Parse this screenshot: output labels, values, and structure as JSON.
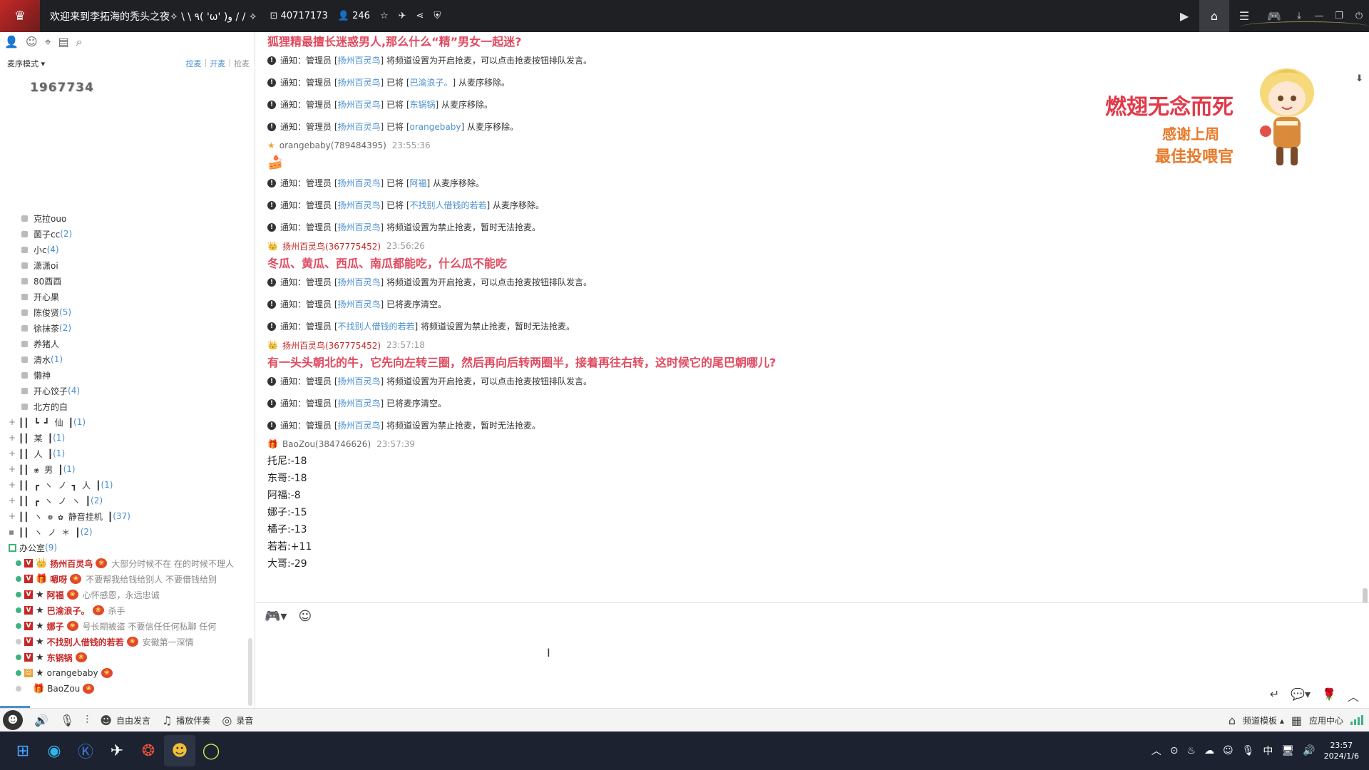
{
  "window": {
    "title": "欢迎来到李拓海的秃头之夜✧ \\ \\ ٩( 'ω' )و / / ✧",
    "channel_id": "40717173",
    "user_count": "246"
  },
  "left": {
    "mode_label": "麦序模式",
    "links": [
      "控麦",
      "开麦",
      "抢麦"
    ],
    "room_id": "1967734",
    "channels": [
      {
        "name": "克拉ouo",
        "count": ""
      },
      {
        "name": "菌子cc",
        "count": "(2)"
      },
      {
        "name": "小c",
        "count": "(4)"
      },
      {
        "name": "潇潇oi",
        "count": ""
      },
      {
        "name": "80酉酉",
        "count": ""
      },
      {
        "name": "开心果",
        "count": ""
      },
      {
        "name": "陈俊贤",
        "count": "(5)"
      },
      {
        "name": "徐抹茶",
        "count": "(2)"
      },
      {
        "name": "养猪人",
        "count": ""
      },
      {
        "name": "清水",
        "count": "(1)"
      },
      {
        "name": "懒神",
        "count": ""
      },
      {
        "name": "开心饺子",
        "count": "(4)"
      },
      {
        "name": "北方的白",
        "count": ""
      }
    ],
    "group_rows": [
      {
        "deco": "┃┃ ┗       ┛           仙   ┃",
        "count": "(1)"
      },
      {
        "deco": "┃┃                      某   ┃",
        "count": "(1)"
      },
      {
        "deco": "┃┃                      人   ┃",
        "count": "(1)"
      },
      {
        "deco": "┃┃        ❀             男   ┃",
        "count": "(1)"
      },
      {
        "deco": "┃┃    ┏ ヽ ノ ┓          人   ┃",
        "count": "(1)"
      },
      {
        "deco": "┃┃ ┏ ヽ     ノ ヽ            ┃",
        "count": "(2)"
      },
      {
        "deco": "┃┃  ヽ  ❁  ✿  静音挂机     ┃",
        "count": "(37)"
      },
      {
        "deco": "┃┃   ヽ ノ      ＊           ┃",
        "count": "(2)"
      }
    ],
    "office": {
      "name": "办公室",
      "count": "(9)"
    },
    "members": [
      {
        "online": true,
        "name": "扬州百灵鸟",
        "sig": "大部分时候不在  在的时候不理人",
        "bold": true
      },
      {
        "online": true,
        "name": "嗯呀",
        "sig": "不要帮我给钱给别人  不要借钱给别",
        "bold": true
      },
      {
        "online": true,
        "name": "阿福",
        "sig": "心怀感恩，永远忠诚",
        "bold": true
      },
      {
        "online": true,
        "name": "巴渝浪子。",
        "sig": "杀手",
        "bold": true
      },
      {
        "online": true,
        "name": "娜子",
        "sig": "号长期被盗  不要信任任何私聊  任何",
        "bold": true
      },
      {
        "online": false,
        "name": "不找别人借钱的若若",
        "sig": "安徽第一深情",
        "bold": true
      },
      {
        "online": true,
        "name": "东锅锅",
        "sig": "",
        "bold": true
      },
      {
        "online": true,
        "name": "orangebaby",
        "sig": "",
        "bold": false
      },
      {
        "online": false,
        "name": "BaoZou",
        "sig": "",
        "bold": false
      }
    ]
  },
  "chat": {
    "q1": "狐狸精最擅长迷惑男人,那么什么“精”男女一起迷?",
    "n_notice": "通知：管理员 [",
    "admin": "扬州百灵鸟",
    "t_open": "] 将频道设置为开启抢麦，可以点击抢麦按钮排队发言。",
    "t_removed_pre": "] 已将 [",
    "t_removed_post": "] 从麦序移除。",
    "t_ban": "] 将频道设置为禁止抢麦，暂时无法抢麦。",
    "t_clear": "] 已将麦序清空。",
    "u1": "巴渝浪子。",
    "u2": "东锅锅",
    "u3": "orangebaby",
    "u4": "阿福",
    "u5": "不找别人借钱的若若",
    "orangebaby_head": "orangebaby(789484395)",
    "orangebaby_time": "23:55:36",
    "bl_head": "扬州百灵鸟(367775452)",
    "bl_time1": "23:56:26",
    "q2": "冬瓜、黄瓜、西瓜、南瓜都能吃，什么瓜不能吃",
    "bl_time2": "23:57:18",
    "q3": "有一头头朝北的牛，它先向左转三圈，然后再向后转两圈半，接着再往右转，这时候它的尾巴朝哪儿?",
    "baozou_head": "BaoZou(384746626)",
    "baozou_time": "23:57:39",
    "scores": [
      "托尼:-18",
      "东哥:-18",
      "阿福:-8",
      "娜子:-15",
      "橘子:-13",
      "若若:+11",
      "大哥:-29"
    ]
  },
  "banner": {
    "line1": "燃翅无念而死",
    "line2": "感谢上周",
    "line3": "最佳投喂官"
  },
  "bottombar": {
    "free_talk": "自由发言",
    "accompany": "播放伴奏",
    "record": "录音",
    "template": "频道模板",
    "app_center": "应用中心"
  },
  "taskbar": {
    "ime": "中",
    "time": "23:57",
    "date": "2024/1/6"
  }
}
